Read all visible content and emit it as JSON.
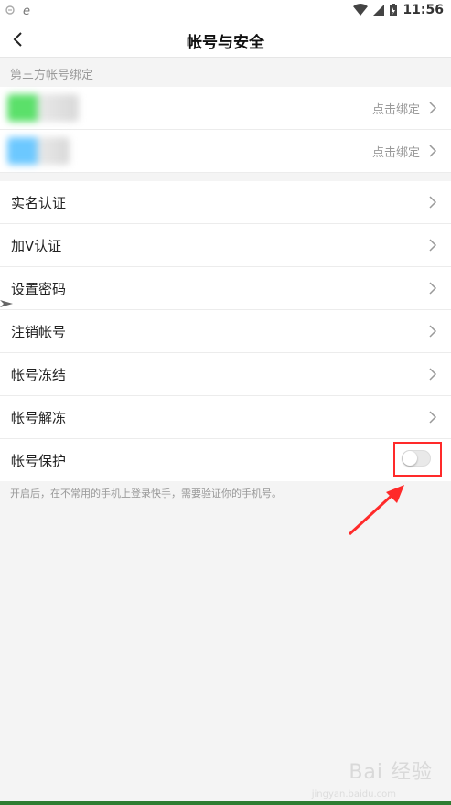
{
  "statusbar": {
    "time": "11:56"
  },
  "nav": {
    "title": "帐号与安全"
  },
  "third_party": {
    "header": "第三方帐号绑定",
    "rows": [
      {
        "action": "点击绑定",
        "color": "#5be06a"
      },
      {
        "action": "点击绑定",
        "color": "#6cc8ff"
      }
    ]
  },
  "menu": {
    "items": [
      {
        "label": "实名认证"
      },
      {
        "label": "加V认证"
      },
      {
        "label": "设置密码"
      },
      {
        "label": "注销帐号"
      },
      {
        "label": "帐号冻结"
      },
      {
        "label": "帐号解冻"
      }
    ],
    "protect": {
      "label": "帐号保护",
      "enabled": false
    },
    "protect_hint": "开启后，在不常用的手机上登录快手，需要验证你的手机号。"
  },
  "annotation": {
    "color": "#ff2a2a"
  },
  "watermark": {
    "text": "Bai 经验",
    "sub": "jingyan.baidu.com"
  }
}
